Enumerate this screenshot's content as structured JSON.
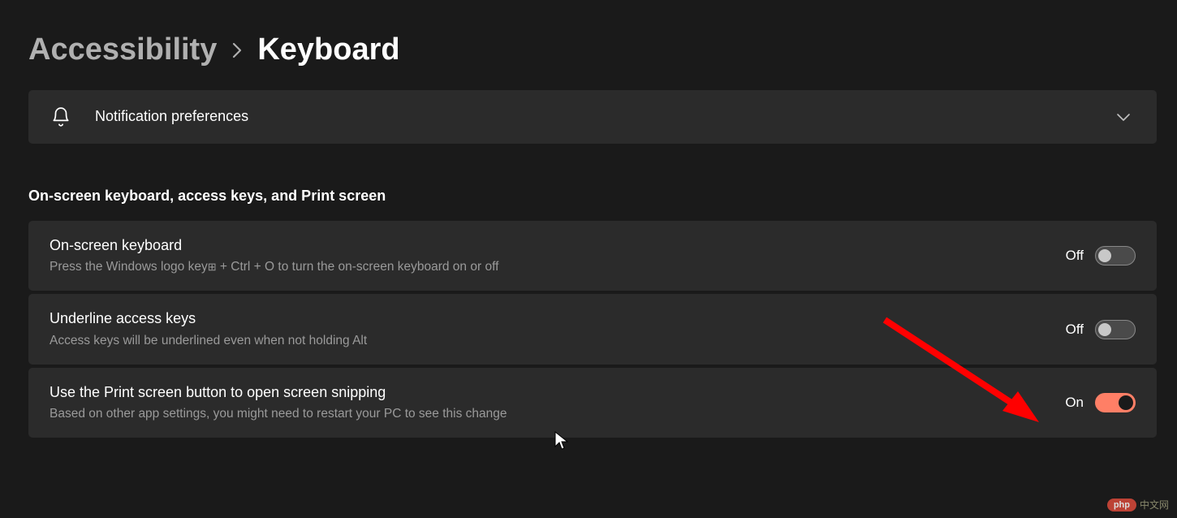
{
  "breadcrumb": {
    "parent": "Accessibility",
    "current": "Keyboard"
  },
  "notification_card": {
    "title": "Notification preferences"
  },
  "section_heading": "On-screen keyboard, access keys, and Print screen",
  "rows": [
    {
      "title": "On-screen keyboard",
      "desc_pre": "Press the Windows logo key",
      "desc_post": " + Ctrl + O to turn the on-screen keyboard on or off",
      "state_label": "Off",
      "on": false
    },
    {
      "title": "Underline access keys",
      "desc": "Access keys will be underlined even when not holding Alt",
      "state_label": "Off",
      "on": false
    },
    {
      "title": "Use the Print screen button to open screen snipping",
      "desc": "Based on other app settings, you might need to restart your PC to see this change",
      "state_label": "On",
      "on": true
    }
  ],
  "watermark": {
    "badge": "php",
    "text": "中文网"
  }
}
